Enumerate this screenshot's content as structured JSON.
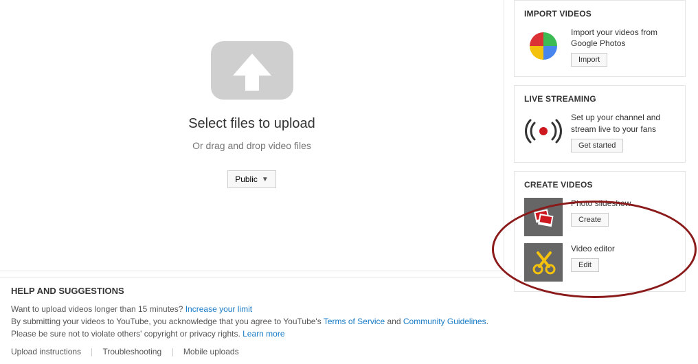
{
  "upload": {
    "title": "Select files to upload",
    "subtitle": "Or drag and drop video files",
    "privacy_selected": "Public"
  },
  "help": {
    "heading": "HELP AND SUGGESTIONS",
    "line1_a": "Want to upload videos longer than 15 minutes? ",
    "line1_link": "Increase your limit",
    "line2_a": "By submitting your videos to YouTube, you acknowledge that you agree to YouTube's ",
    "line2_tos": "Terms of Service",
    "line2_and": " and ",
    "line2_cg": "Community Guidelines",
    "line2_end": ".",
    "line3_a": "Please be sure not to violate others' copyright or privacy rights. ",
    "line3_link": "Learn more",
    "links": {
      "upload_instructions": "Upload instructions",
      "troubleshooting": "Troubleshooting",
      "mobile_uploads": "Mobile uploads"
    }
  },
  "right": {
    "import": {
      "title": "IMPORT VIDEOS",
      "desc": "Import your videos from Google Photos",
      "button": "Import"
    },
    "live": {
      "title": "LIVE STREAMING",
      "desc": "Set up your channel and stream live to your fans",
      "button": "Get started"
    },
    "create": {
      "title": "CREATE VIDEOS",
      "slideshow": {
        "label": "Photo slideshow",
        "button": "Create"
      },
      "editor": {
        "label": "Video editor",
        "button": "Edit"
      }
    }
  }
}
